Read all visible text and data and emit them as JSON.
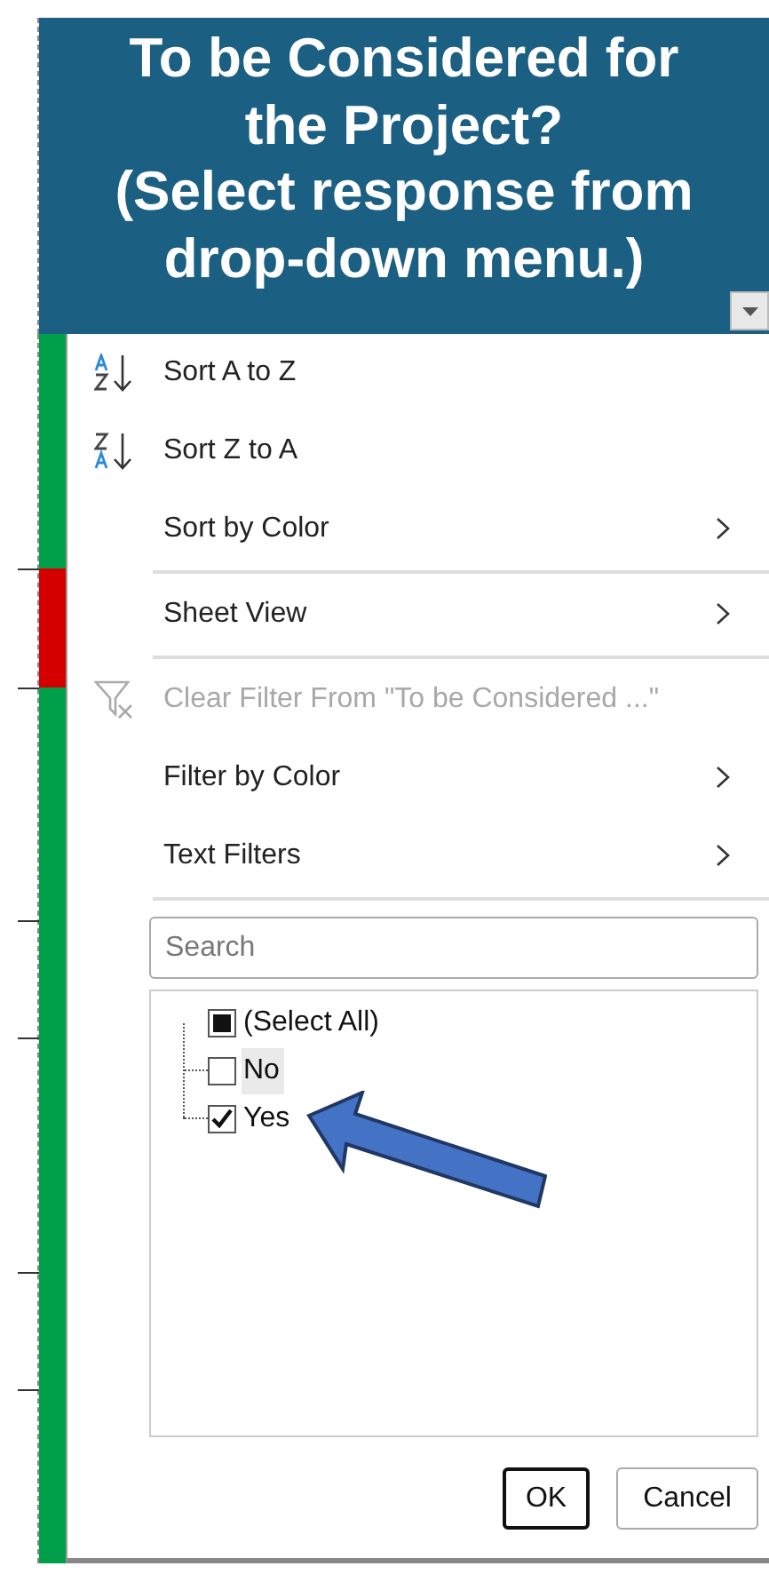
{
  "header": {
    "title_lines": [
      "To be Considered for",
      "the Project?",
      "(Select response from",
      "drop-down menu.)"
    ]
  },
  "status_cells": [
    {
      "color": "#00a04a"
    },
    {
      "color": "#d40000"
    },
    {
      "color": "#00a04a"
    }
  ],
  "menu": {
    "items": [
      {
        "kind": "sort_asc",
        "label": "Sort A to Z",
        "disabled": false
      },
      {
        "kind": "sort_desc",
        "label": "Sort Z to A",
        "disabled": false
      },
      {
        "kind": "submenu",
        "label": "Sort by Color",
        "disabled": false
      },
      {
        "kind": "separator"
      },
      {
        "kind": "submenu",
        "label": "Sheet View",
        "disabled": false
      },
      {
        "kind": "separator"
      },
      {
        "kind": "clear_filter",
        "label": "Clear Filter From \"To be Considered ...\"",
        "disabled": true
      },
      {
        "kind": "submenu",
        "label": "Filter by Color",
        "disabled": false
      },
      {
        "kind": "submenu",
        "label": "Text Filters",
        "disabled": false
      },
      {
        "kind": "separator"
      }
    ],
    "search": {
      "placeholder": "Search"
    },
    "values": [
      {
        "label": "(Select All)",
        "partial": true,
        "highlighted": false,
        "children": [
          {
            "label": "No",
            "checked": false,
            "highlighted": true
          },
          {
            "label": "Yes",
            "checked": true,
            "highlighted": false
          }
        ]
      }
    ],
    "buttons": [
      {
        "label": "OK",
        "default": true
      },
      {
        "label": "Cancel",
        "default": false
      }
    ]
  }
}
